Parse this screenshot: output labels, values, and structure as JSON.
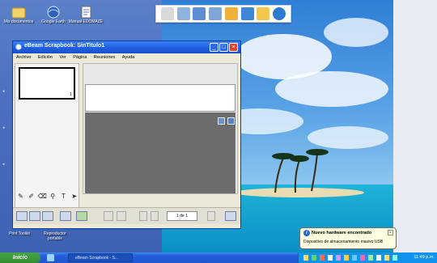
{
  "desktop": {
    "icons": [
      {
        "label": "Mis documentos",
        "icon": "folder-icon"
      },
      {
        "label": "Google Earth",
        "icon": "globe-icon"
      },
      {
        "label": "Manual EDOMAZE",
        "icon": "document-icon"
      }
    ],
    "bottom_icons": [
      {
        "label": "Print Toolkit",
        "icon": "print-icon"
      },
      {
        "label": "Reproductor portable",
        "icon": "media-icon"
      }
    ]
  },
  "quick_toolbar": {
    "buttons": [
      "pointer-icon",
      "screen-icon",
      "image-icon",
      "folder-icon",
      "notebook-icon",
      "paint-icon",
      "chart-icon",
      "globe-icon"
    ]
  },
  "window": {
    "title": "eBeam Scrapbook: SinTitulo1",
    "menu": [
      "Archivo",
      "Edición",
      "Ver",
      "Página",
      "Reuniones",
      "Ayuda"
    ],
    "thumbnail_number": "1",
    "tools": [
      "pen-icon",
      "marker-icon",
      "eraser-icon",
      "zoom-icon",
      "T",
      "cursor-icon"
    ],
    "page_indicator": "1 de 1"
  },
  "taskbar": {
    "start_label": "Inicio",
    "app_button": "eBeam Scrapbook - S...",
    "clock": "11:49 p.m."
  },
  "balloon": {
    "title": "Nuevo hardware encontrado",
    "message": "Dispositivo de almacenamiento masivo USB"
  },
  "colors": {
    "desktop_blue": "#4c70bf",
    "titlebar_blue": "#1f5fe0",
    "taskbar_blue": "#245edc",
    "start_green": "#3b9b3b"
  }
}
